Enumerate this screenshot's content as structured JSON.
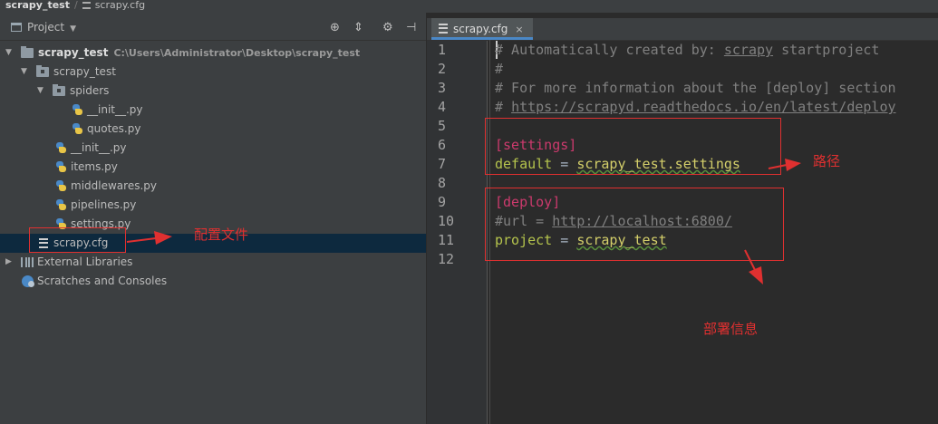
{
  "breadcrumb": {
    "project": "scrapy_test",
    "file": "scrapy.cfg"
  },
  "project_panel": {
    "title": "Project",
    "toolbar_icons": [
      "locate-icon",
      "collapse-icon",
      "settings-icon",
      "hide-icon"
    ],
    "tree": [
      {
        "label": "scrapy_test",
        "path": "C:\\Users\\Administrator\\Desktop\\scrapy_test",
        "icon": "folder-icon",
        "expanded": true
      },
      {
        "label": "scrapy_test",
        "icon": "package-icon",
        "expanded": true
      },
      {
        "label": "spiders",
        "icon": "package-icon",
        "expanded": true
      },
      {
        "label": "__init__.py",
        "icon": "python-file-icon"
      },
      {
        "label": "quotes.py",
        "icon": "python-file-icon"
      },
      {
        "label": "__init__.py",
        "icon": "python-file-icon"
      },
      {
        "label": "items.py",
        "icon": "python-file-icon"
      },
      {
        "label": "middlewares.py",
        "icon": "python-file-icon"
      },
      {
        "label": "pipelines.py",
        "icon": "python-file-icon"
      },
      {
        "label": "settings.py",
        "icon": "python-file-icon"
      },
      {
        "label": "scrapy.cfg",
        "icon": "config-file-icon",
        "selected": true
      },
      {
        "label": "External Libraries",
        "icon": "library-icon",
        "expanded": false
      },
      {
        "label": "Scratches and Consoles",
        "icon": "scratches-icon"
      }
    ]
  },
  "editor": {
    "tab": "scrapy.cfg",
    "line_numbers": [
      "1",
      "2",
      "3",
      "4",
      "5",
      "6",
      "7",
      "8",
      "9",
      "10",
      "11",
      "12"
    ],
    "lines": {
      "l1": "# Automatically created by: ",
      "l1_u": "scrapy",
      "l1_b": " startproject",
      "l2": "#",
      "l3": "# For more information about the [deploy] section",
      "l4": "# ",
      "l4_u": "https://scrapyd.readthedocs.io/en/latest/deploy",
      "l6": "[settings]",
      "l7_k": "default",
      "l7_op": " = ",
      "l7_v": "scrapy_test.settings",
      "l9": "[deploy]",
      "l10": "#url = ",
      "l10_u": "http://localhost:6800/",
      "l11_k": "project",
      "l11_op": " = ",
      "l11_v": "scrapy_test"
    }
  },
  "annotations": {
    "config_file": "配置文件",
    "path": "路径",
    "deploy_info": "部署信息",
    "color": "#e03030"
  }
}
